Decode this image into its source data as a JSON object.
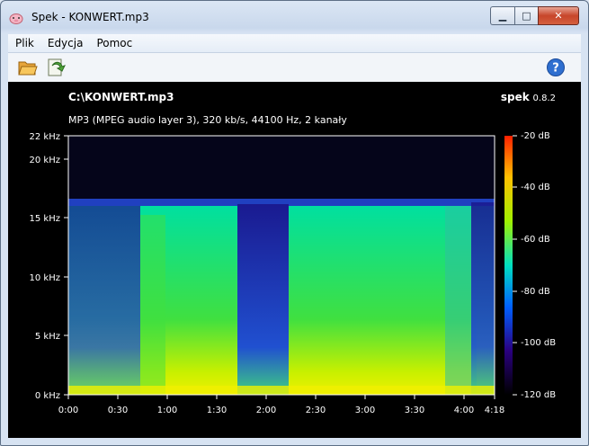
{
  "window": {
    "title": "Spek - KONWERT.mp3",
    "minimize_glyph": "▁",
    "maximize_glyph": "□",
    "close_glyph": "✕",
    "app_icon": "pig-icon"
  },
  "menu": {
    "items": [
      {
        "label": "Plik"
      },
      {
        "label": "Edycja"
      },
      {
        "label": "Pomoc"
      }
    ]
  },
  "toolbar": {
    "buttons": [
      {
        "icon": "folder-open-icon"
      },
      {
        "icon": "save-icon"
      }
    ],
    "help_icon": "help-icon",
    "help_glyph": "?"
  },
  "spectrogram": {
    "file": "C:\\KONWERT.mp3",
    "info": "MP3 (MPEG audio layer 3), 320 kb/s, 44100 Hz, 2 kanały",
    "app_name": "spek",
    "version": "0.8.2",
    "freq_ticks": [
      "22 kHz",
      "20 kHz",
      "15 kHz",
      "10 kHz",
      "5 kHz",
      "0 kHz"
    ],
    "time_ticks": [
      "0:00",
      "0:30",
      "1:00",
      "1:30",
      "2:00",
      "2:30",
      "3:00",
      "3:30",
      "4:00",
      "4:18"
    ],
    "db_ticks": [
      "-20 dB",
      "-40 dB",
      "-60 dB",
      "-80 dB",
      "-100 dB",
      "-120 dB"
    ],
    "colors": {
      "background": "#000000",
      "quiet": "#1a0a5e",
      "mid": "#00e08a",
      "loud": "#f0f000"
    }
  }
}
